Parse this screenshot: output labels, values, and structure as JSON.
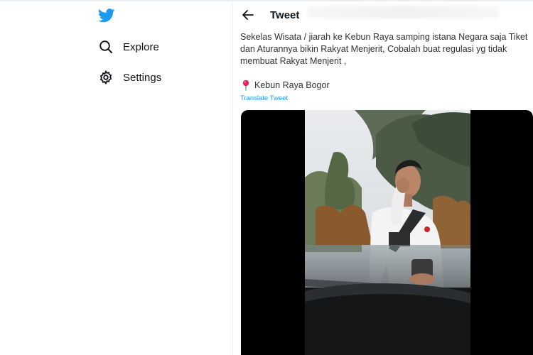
{
  "sidebar": {
    "logo_icon": "twitter-bird-icon",
    "items": [
      {
        "label": "Explore",
        "icon": "hash-search-icon"
      },
      {
        "label": "Settings",
        "icon": "gear-icon"
      }
    ]
  },
  "header": {
    "back_icon": "arrow-left-icon",
    "title": "Tweet"
  },
  "tweet": {
    "text": "Sekelas Wisata / jiarah ke Kebun Raya samping istana Negara saja  Tiket dan Aturannya bikin Rakyat Menjerit, Cobalah buat regulasi yg tidak membuat Rakyat Menjerit ,",
    "location_icon": "round-pushpin-icon",
    "location": "Kebun Raya Bogor",
    "translate": "Translate Tweet"
  },
  "colors": {
    "brand": "#1d9bf0",
    "text": "#0f1419",
    "divider": "#eff3f4"
  }
}
